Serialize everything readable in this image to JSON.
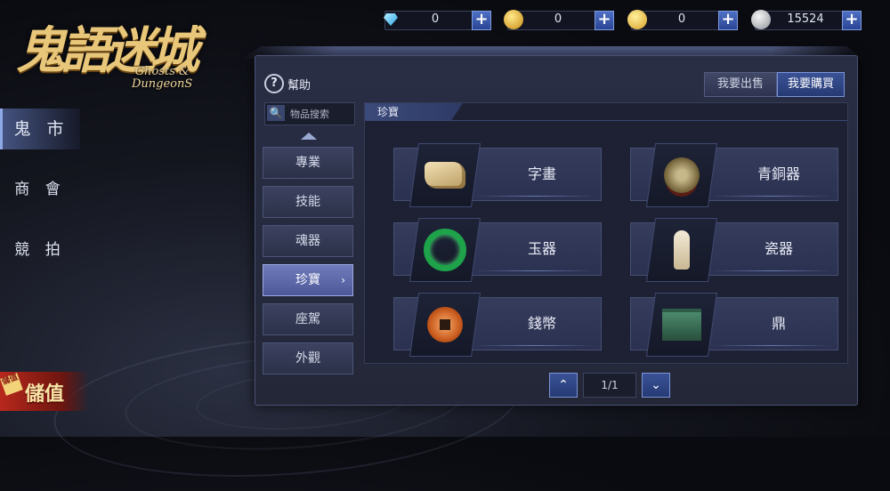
{
  "logo": {
    "cn": "鬼語迷城",
    "en_line1": "Ghosts &",
    "en_line2": "DungeonS"
  },
  "left_nav": [
    {
      "label": "鬼 市",
      "active": true
    },
    {
      "label": "商 會",
      "active": false
    },
    {
      "label": "競 拍",
      "active": false
    }
  ],
  "topup": {
    "tag": "儲值",
    "label": "儲值"
  },
  "currency": [
    {
      "icon": "diamond-icon",
      "value": "0"
    },
    {
      "icon": "gold-ingot-icon",
      "value": "0"
    },
    {
      "icon": "gold-coin-icon",
      "value": "0"
    },
    {
      "icon": "silver-coin-icon",
      "value": "15524"
    }
  ],
  "panel": {
    "help_label": "幫助",
    "sell_label": "我要出售",
    "buy_label": "我要購買",
    "search_placeholder": "物品搜索",
    "section_title": "珍寶"
  },
  "categories": [
    {
      "label": "專業",
      "active": false
    },
    {
      "label": "技能",
      "active": false
    },
    {
      "label": "魂器",
      "active": false
    },
    {
      "label": "珍寶",
      "active": true
    },
    {
      "label": "座駕",
      "active": false
    },
    {
      "label": "外觀",
      "active": false
    }
  ],
  "items": [
    {
      "label": "字畫",
      "icon": "scroll-painting-icon"
    },
    {
      "label": "青銅器",
      "icon": "bronze-mirror-icon"
    },
    {
      "label": "玉器",
      "icon": "jade-bracelet-icon"
    },
    {
      "label": "瓷器",
      "icon": "porcelain-figure-icon"
    },
    {
      "label": "錢幣",
      "icon": "ancient-coin-icon"
    },
    {
      "label": "鼎",
      "icon": "bronze-cauldron-icon"
    }
  ],
  "pager": {
    "text": "1/1"
  }
}
